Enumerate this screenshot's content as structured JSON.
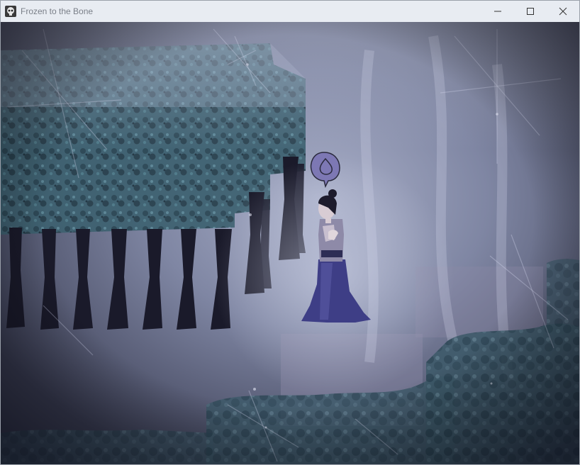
{
  "window": {
    "title": "Frozen to the Bone",
    "app_icon": "skull-icon",
    "controls": [
      "minimize-icon",
      "maximize-icon",
      "close-icon"
    ]
  },
  "scene": {
    "palette": {
      "sky": "#6a6f88",
      "fog": "#b9bfd4",
      "foliage": "#3c5f6e",
      "trunk": "#1b1a2b",
      "dress": "#3f3f86",
      "bubble": "#7d78b4"
    },
    "speech_bubble_icon": "flame-drop-icon"
  }
}
